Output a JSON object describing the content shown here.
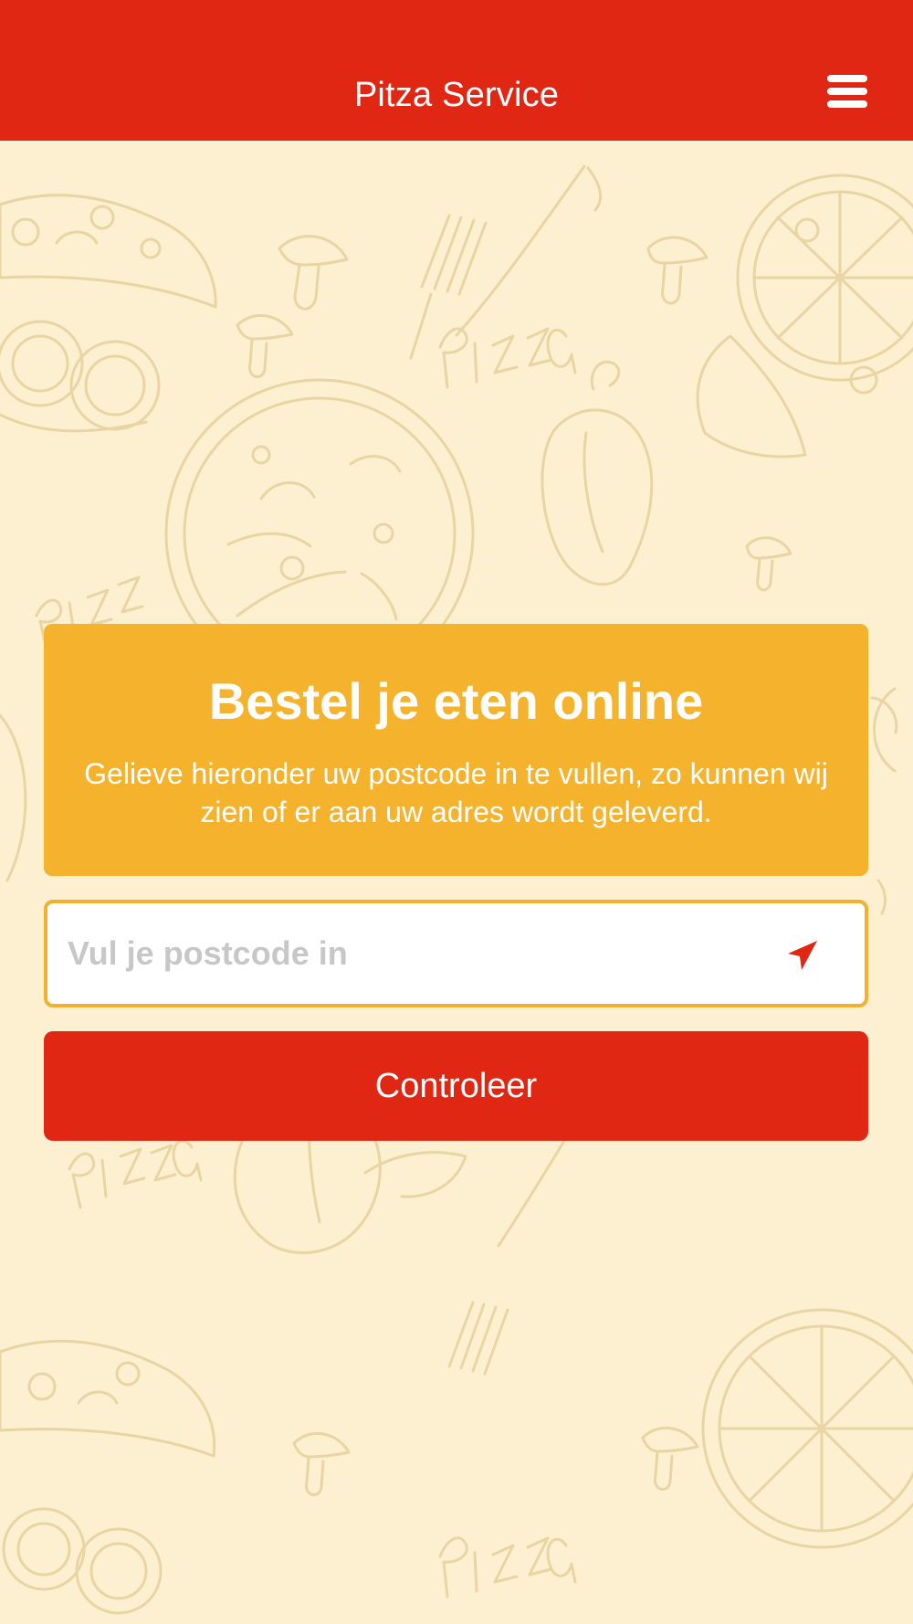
{
  "header": {
    "title": "Pitza Service",
    "menu_icon": "hamburger-icon"
  },
  "hero": {
    "title": "Bestel je eten online",
    "text": "Gelieve hieronder uw postcode in te vullen, zo kunnen wij zien of er aan uw adres wordt geleverd."
  },
  "postcode": {
    "placeholder": "Vul je postcode in",
    "value": "",
    "location_icon": "location-arrow-icon"
  },
  "actions": {
    "controleer_label": "Controleer"
  },
  "theme": {
    "brand_red": "#e02714",
    "card_yellow": "#f4b22d",
    "background": "#fdf0d0"
  }
}
